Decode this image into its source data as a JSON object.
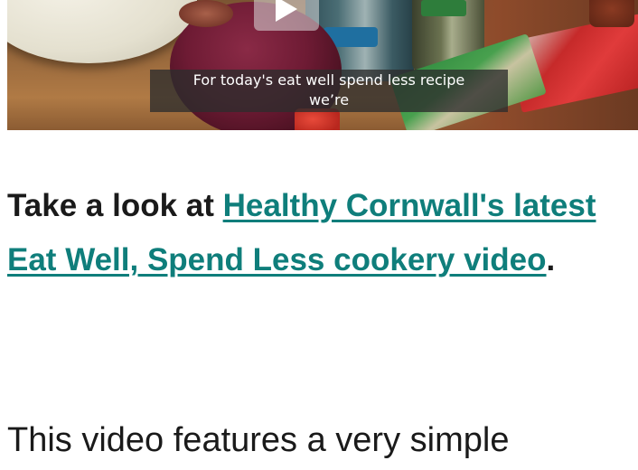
{
  "video": {
    "caption_line1": "For today's eat well spend less recipe",
    "caption_line2": "we’re"
  },
  "article": {
    "heading_prefix": "Take a look at ",
    "heading_link": "Healthy Cornwall's latest Eat Well, Spend Less cookery video",
    "heading_suffix": ".",
    "body_start": "This video features a very simple"
  },
  "colors": {
    "link": "#0f7e7b",
    "text": "#1a1a1a"
  }
}
